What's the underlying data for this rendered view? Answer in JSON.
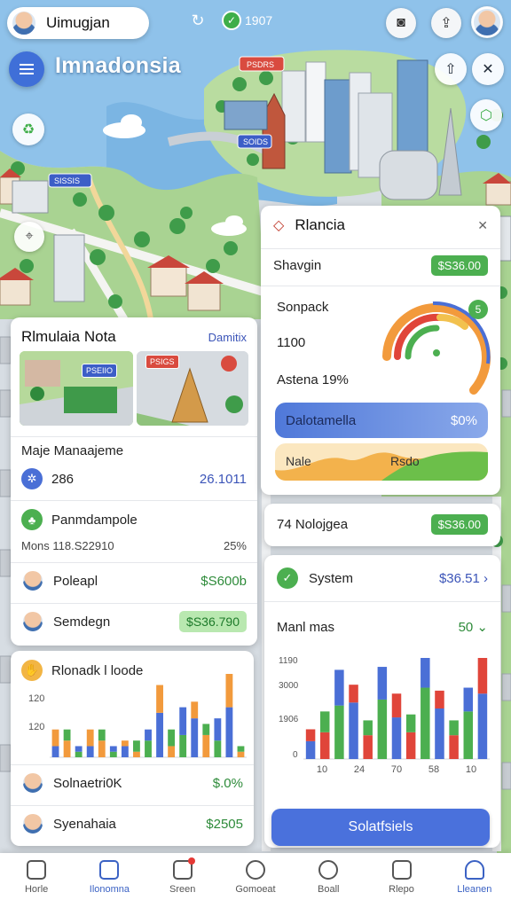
{
  "header": {
    "user_name": "Uimugjan",
    "status_value": "1907",
    "app_title": "Imnadonsia"
  },
  "icons": {
    "menu": "menu-icon",
    "user": "user-icon",
    "sync": "sync-icon",
    "check": "check-icon",
    "camera": "camera-icon",
    "share": "share-icon",
    "close": "close-icon",
    "layers": "layers-icon",
    "recycle": "recycle-icon"
  },
  "map_labels": [
    "PSDRS",
    "SOIDS",
    "SISSIS"
  ],
  "left_panel": {
    "header_title": "Rlmulaia Nota",
    "header_link": "Damitix",
    "photo_tags": [
      "PSEIIO",
      "PSIGS"
    ],
    "section1_title": "Maje Manaajeme",
    "section1_value": "286",
    "section1_right": "26.1011",
    "section2_title": "Panmdampole",
    "section2_sub": "Mons 118.S22910",
    "section2_right": "25%",
    "person_rows": [
      {
        "name": "Poleapl",
        "value": "$S600b"
      },
      {
        "name": "Semdegn",
        "value": "$S36.790"
      }
    ]
  },
  "left_chart_card": {
    "title": "Rlonadk l loode",
    "y_ticks": [
      "120",
      "120"
    ],
    "person_rows": [
      {
        "name": "Solnaetri0K",
        "value": "$.0%"
      },
      {
        "name": "Syenahaia",
        "value": "$2505"
      }
    ]
  },
  "right_panel": {
    "header_title": "Rlancia",
    "shavgin_label": "Shavgin",
    "shavgin_value": "$S36.00",
    "sonpack_label": "Sonpack",
    "sonpack_value": "1100",
    "astena_label": "Astena 19%",
    "gauge_badge": "5",
    "bar_label": "Dalotamella",
    "bar_value": "$0%",
    "area_left": "Nale",
    "area_right": "Rsdo"
  },
  "right_nolo": {
    "label": "74 Nolojgea",
    "value": "$S36.00"
  },
  "right_system": {
    "label": "System",
    "value": "$36.51",
    "chevron": "›"
  },
  "right_chart": {
    "title": "Manl mas",
    "right_value": "50",
    "y_ticks": [
      "1190",
      "3000",
      "1906",
      "0"
    ],
    "x_ticks": [
      "10",
      "24",
      "70",
      "58",
      "10"
    ]
  },
  "primary_button": "Solatfsiels",
  "nav": [
    {
      "label": "Horle"
    },
    {
      "label": "Ilonomna"
    },
    {
      "label": "Sreen"
    },
    {
      "label": "Gomoeat"
    },
    {
      "label": "Boall"
    },
    {
      "label": "Rlepo"
    },
    {
      "label": "Lleanen"
    }
  ],
  "chart_data": [
    {
      "type": "bar",
      "title": "Rlonadk l loode",
      "y_ticks": [
        "120",
        "120"
      ],
      "series": [
        {
          "values": [
            2,
            3,
            1,
            2,
            3,
            1,
            2,
            1,
            3,
            8,
            2,
            4,
            7,
            4,
            3,
            9,
            1
          ]
        },
        {
          "values": [
            3,
            2,
            1,
            3,
            2,
            1,
            1,
            2,
            2,
            5,
            3,
            5,
            3,
            2,
            4,
            6,
            1
          ]
        }
      ],
      "colors": [
        "#4a6fd6",
        "#f29a3c",
        "#4caf50",
        "#d0d4dc"
      ]
    },
    {
      "type": "bar",
      "title": "Manl mas",
      "ylabel_ticks": [
        "1190",
        "3000",
        "1906",
        "0"
      ],
      "x_ticks": [
        "10",
        "24",
        "70",
        "58",
        "10"
      ],
      "series": [
        {
          "name": "",
          "values": [
            30,
            45,
            90,
            95,
            40,
            100,
            70,
            45,
            120,
            85,
            40,
            80,
            110
          ]
        },
        {
          "name": "",
          "values": [
            20,
            35,
            60,
            30,
            25,
            55,
            40,
            30,
            50,
            30,
            25,
            40,
            60
          ]
        }
      ],
      "colors": [
        "#4a6fd6",
        "#e0453a",
        "#4caf50",
        "#d0d4dc"
      ]
    }
  ]
}
